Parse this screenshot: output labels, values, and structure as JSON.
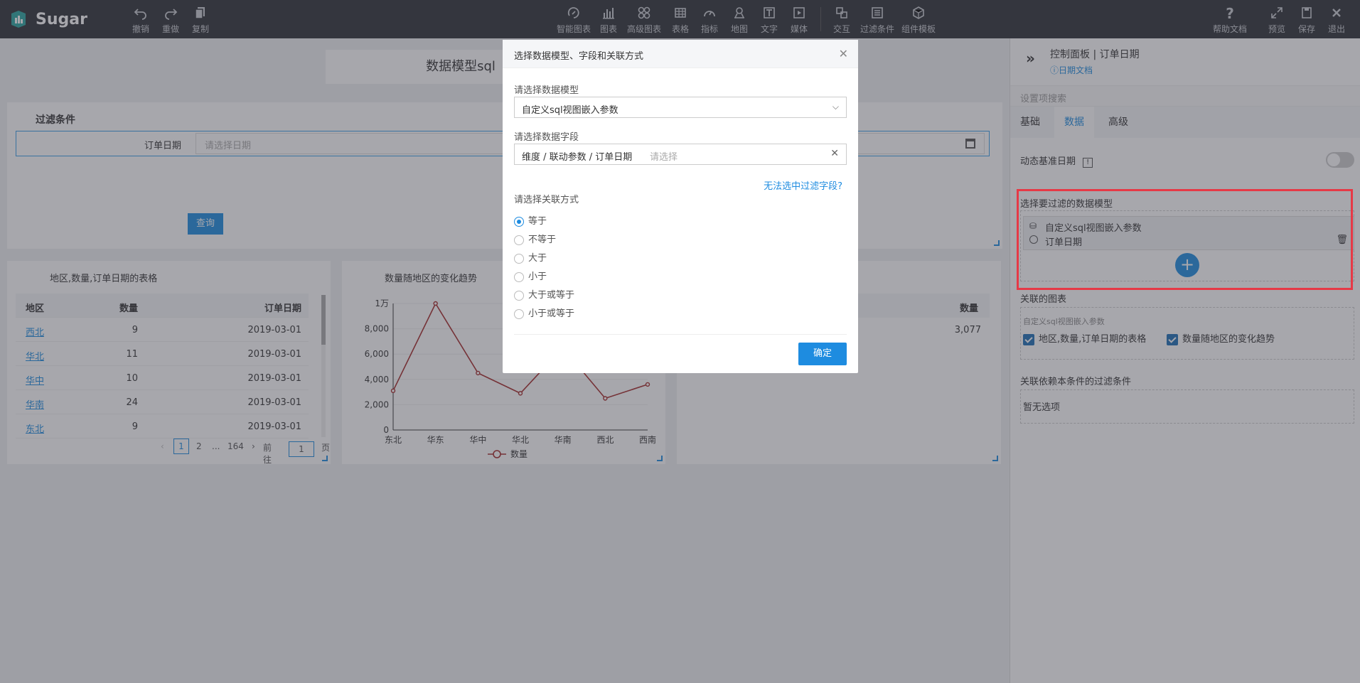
{
  "app": {
    "name": "Sugar"
  },
  "toolbar": {
    "left": [
      {
        "label": "撤销",
        "icon": "undo-icon"
      },
      {
        "label": "重做",
        "icon": "redo-icon"
      },
      {
        "label": "复制",
        "icon": "copy-icon"
      }
    ],
    "center": [
      {
        "label": "智能图表",
        "icon": "smart-chart-icon"
      },
      {
        "label": "图表",
        "icon": "bar-chart-icon"
      },
      {
        "label": "高级图表",
        "icon": "advanced-chart-icon"
      },
      {
        "label": "表格",
        "icon": "table-icon"
      },
      {
        "label": "指标",
        "icon": "gauge-icon"
      },
      {
        "label": "地图",
        "icon": "map-pin-icon"
      },
      {
        "label": "文字",
        "icon": "text-icon"
      },
      {
        "label": "媒体",
        "icon": "media-icon"
      },
      {
        "label": "交互",
        "icon": "interaction-icon"
      },
      {
        "label": "过滤条件",
        "icon": "filter-icon"
      },
      {
        "label": "组件模板",
        "icon": "template-icon"
      }
    ],
    "right": [
      {
        "label": "帮助文档",
        "icon": "help-icon"
      },
      {
        "label": "预览",
        "icon": "expand-icon"
      },
      {
        "label": "保存",
        "icon": "save-icon"
      },
      {
        "label": "退出",
        "icon": "close-icon"
      }
    ]
  },
  "canvas": {
    "title": "数据模型sql",
    "filter": {
      "title": "过滤条件",
      "field_label": "订单日期",
      "placeholder": "请选择日期",
      "query_label": "查询"
    },
    "table": {
      "title": "地区,数量,订单日期的表格",
      "headers": [
        "地区",
        "数量",
        "订单日期"
      ],
      "rows": [
        [
          "西北",
          "9",
          "2019-03-01"
        ],
        [
          "华北",
          "11",
          "2019-03-01"
        ],
        [
          "华中",
          "10",
          "2019-03-01"
        ],
        [
          "华南",
          "24",
          "2019-03-01"
        ],
        [
          "东北",
          "9",
          "2019-03-01"
        ]
      ],
      "pager": {
        "prev": "‹",
        "current": "1",
        "p2": "2",
        "dots": "...",
        "last": "164",
        "next": "›",
        "goto": "前往",
        "input": "1",
        "page": "页"
      }
    },
    "right_table": {
      "header": "数量",
      "value": "3,077"
    }
  },
  "chart_data": {
    "type": "line",
    "title": "数量随地区的变化趋势",
    "categories": [
      "东北",
      "华东",
      "华中",
      "华北",
      "华南",
      "西北",
      "西南"
    ],
    "series": [
      {
        "name": "数量",
        "values": [
          3100,
          10000,
          4500,
          2900,
          6500,
          2500,
          3600
        ]
      }
    ],
    "ylim": [
      0,
      10000
    ],
    "yticks": [
      "0",
      "2,000",
      "4,000",
      "6,000",
      "8,000",
      "1万"
    ],
    "color": "#a52a2a",
    "legend": "bottom"
  },
  "dialog": {
    "title": "选择数据模型、字段和关联方式",
    "model_label": "请选择数据模型",
    "model_value": "自定义sql视图嵌入参数",
    "field_label": "请选择数据字段",
    "field_value": "维度 / 联动参数 / 订单日期",
    "field_placeholder": "请选择",
    "field_link": "无法选中过滤字段?",
    "relation_label": "请选择关联方式",
    "relations": [
      "等于",
      "不等于",
      "大于",
      "小于",
      "大于或等于",
      "小于或等于"
    ],
    "selected_relation": "等于",
    "ok": "确定"
  },
  "panel": {
    "title": "控制面板 | 订单日期",
    "doc_link": "日期文档",
    "search_placeholder": "设置项搜索",
    "tabs": [
      "基础",
      "数据",
      "高级"
    ],
    "active_tab": "数据",
    "dynamic_date": "动态基准日期",
    "model_section": "选择要过滤的数据模型",
    "model_name": "自定义sql视图嵌入参数",
    "model_field": "订单日期",
    "related_title": "关联的图表",
    "related_model": "自定义sql视图嵌入参数",
    "related_charts": [
      "地区,数量,订单日期的表格",
      "数量随地区的变化趋势"
    ],
    "dep_title": "关联依赖本条件的过滤条件",
    "dep_empty": "暂无选项"
  }
}
